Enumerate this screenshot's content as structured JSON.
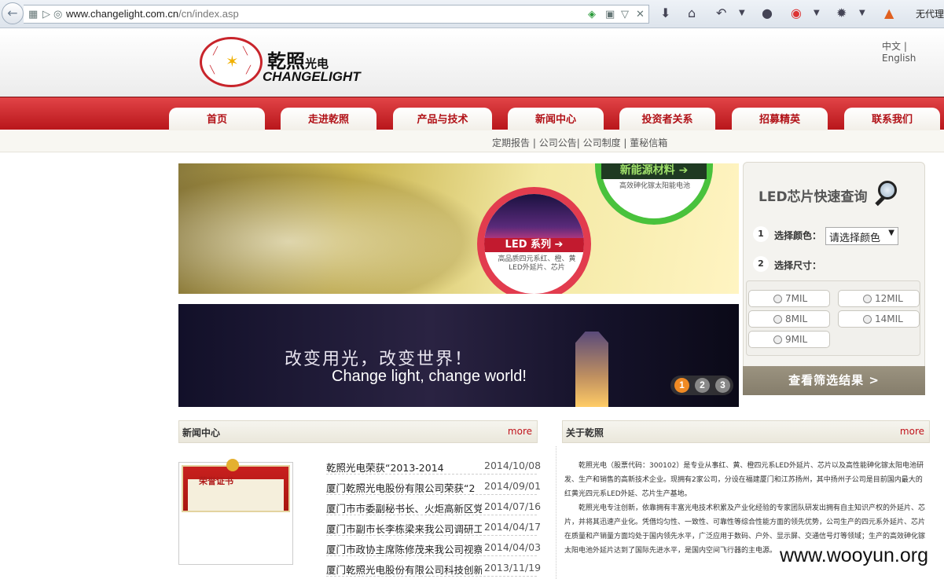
{
  "browser": {
    "url_host": "www.changelight.com.cn",
    "url_path": "/cn/index.asp",
    "bookmark_text": "无代理"
  },
  "header": {
    "logo_cn": "乾照",
    "logo_cn_suffix": "光电",
    "logo_en": "CHANGELIGHT",
    "lang_cn": "中文",
    "lang_sep": "|",
    "lang_en": "English"
  },
  "nav": [
    "首页",
    "走进乾照",
    "产品与技术",
    "新闻中心",
    "投资者关系",
    "招募精英",
    "联系我们"
  ],
  "subnav": [
    "定期报告",
    "公司公告",
    "公司制度",
    "董秘信箱"
  ],
  "banner": {
    "new_energy_label": "新能源材料",
    "new_energy_desc": "高效砷化镓太阳能电池",
    "led_label": "LED 系列",
    "led_desc": "高品质四元系红、橙、黄LED外延片、芯片"
  },
  "slide": {
    "cn": "改变用光，改变世界！",
    "en": "Change light, change world!",
    "pages": [
      "1",
      "2",
      "3"
    ],
    "active_page": 1
  },
  "query": {
    "title": "LED芯片快速查询",
    "step1_num": "1",
    "step1_label": "选择颜色：",
    "color_select": "请选择颜色",
    "step2_num": "2",
    "step2_label": "选择尺寸：",
    "sizes": [
      "7MIL",
      "12MIL",
      "8MIL",
      "14MIL",
      "9MIL"
    ],
    "submit_label": "查看筛选结果  >"
  },
  "news": {
    "title": "新闻中心",
    "more": "more",
    "cert_title": "荣誉证书",
    "items": [
      {
        "title": "乾照光电荣获“2013-2014",
        "date": "2014/10/08"
      },
      {
        "title": "厦门乾照光电股份有限公司荣获“2",
        "date": "2014/09/01"
      },
      {
        "title": "厦门市市委副秘书长、火炬高新区党",
        "date": "2014/07/16"
      },
      {
        "title": "厦门市副市长李栋梁来我公司调研工",
        "date": "2014/04/17"
      },
      {
        "title": "厦门市政协主席陈修茂来我公司视察",
        "date": "2014/04/03"
      },
      {
        "title": "厦门乾照光电股份有限公司科技创新",
        "date": "2013/11/19"
      }
    ]
  },
  "about": {
    "title": "关于乾照",
    "more": "more",
    "para1": "乾照光电（股票代码：300102）是专业从事红、黄、橙四元系LED外延片、芯片以及高性能砷化镓太阳电池研发、生产和销售的高新技术企业。现拥有2家公司，分设在福建厦门和江苏扬州，其中扬州子公司是目前国内最大的红黄光四元系LED外延、芯片生产基地。",
    "para2": "乾照光电专注创新，依靠拥有丰富光电技术积累及产业化经验的专家团队研发出拥有自主知识产权的外延片、芯片，并将其迅速产业化。凭借均匀性、一致性、可靠性等综合性能方面的领先优势，公司生产的四元系外延片、芯片在质量和产销量方面均处于国内领先水平，广泛应用于数码、户外、显示屏、交通信号灯等领域；生产的高效砷化镓太阳电池外延片达到了国际先进水平，是国内空间飞行器的主电源。"
  },
  "watermark": "www.wooyun.org",
  "colors": {
    "brand_red": "#c8242b",
    "led_red": "#e23c4e",
    "new_energy_green": "#49c23c",
    "button_brown": "#8f8773"
  }
}
